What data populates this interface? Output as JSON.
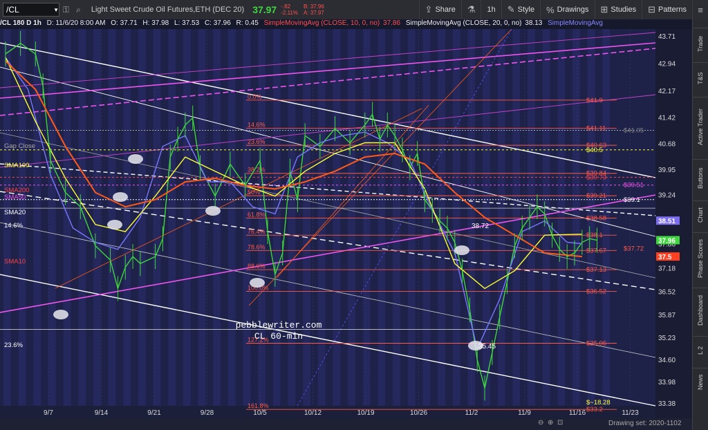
{
  "toolbar": {
    "symbol": "/CL",
    "description": "Light Sweet Crude Oil Futures,ETH (DEC 20)",
    "last": "37.97",
    "change": "-.82",
    "change_pct": "-2.11%",
    "bid": "B: 37.96",
    "ask": "A: 37.97",
    "share": "Share",
    "timeframe": "1h",
    "style": "Style",
    "drawings": "Drawings",
    "studies": "Studies",
    "patterns": "Patterns",
    "colors": {
      "bg": "#2b2d33",
      "last": "#3fd63f",
      "change": "#ff5050"
    }
  },
  "infobar": {
    "title": "/CL 180 D 1h",
    "date": "D: 11/6/20 8:00 AM",
    "open": "O: 37.71",
    "high": "H: 37.98",
    "low": "L: 37.53",
    "close": "C: 37.96",
    "range": "R: 0.45",
    "sma10_label": "SimpleMovingAvg (CLOSE, 10, 0, no)",
    "sma10_value": "37.86",
    "sma20_label": "SimpleMovingAvg (CLOSE, 20, 0, no)",
    "sma20_value": "38.13",
    "sma_cut": "SimpleMovingAvg"
  },
  "right_tabs": [
    "Trade",
    "T&S",
    "Active Trader",
    "Buttons",
    "Chart",
    "Phase Scores",
    "Dashboard",
    "L 2",
    "News"
  ],
  "footer": {
    "drawing_set": "Drawing set: 2020-1102"
  },
  "watermark": {
    "line1": "pebblewriter.com",
    "line2": "CL 60-min"
  },
  "annotations": {
    "gap_close": "Gap Close",
    "sma100": "SMA100",
    "sma200": "SMA200",
    "sma50": "SMA50",
    "sma20": "SMA20",
    "sma10": "SMA10",
    "fib_14_left": "14.6%",
    "fib_23_left": "23.6%",
    "fib_127_left": "127.2%",
    "hi_38_72": "38.72",
    "lo_35_45": "35.45",
    "fib_labels": [
      "0.0%",
      "14.6%",
      "23.6%",
      "38.2%",
      "50%",
      "61.8%",
      "76.4%",
      "78.6%",
      "88.6%",
      "100.0%",
      "127.2%",
      "161.8%"
    ],
    "price_labels": [
      {
        "text": "$41.9",
        "price": 41.9,
        "color": "#ff5a4a"
      },
      {
        "text": "$41.11",
        "price": 41.11,
        "color": "#ff5a4a"
      },
      {
        "text": "$41.05",
        "price": 41.05,
        "color": "#888888"
      },
      {
        "text": "$40.63",
        "price": 40.63,
        "color": "#ff5a4a"
      },
      {
        "text": "$40.5",
        "price": 40.5,
        "color": "#ffff33"
      },
      {
        "text": "$39.84",
        "price": 39.84,
        "color": "#ff5a4a"
      },
      {
        "text": "$39.73",
        "price": 39.73,
        "color": "#ff4444"
      },
      {
        "text": "$39.51",
        "price": 39.51,
        "color": "#ee55ee"
      },
      {
        "text": "$39.21",
        "price": 39.21,
        "color": "#ff5a4a"
      },
      {
        "text": "$39.1",
        "price": 39.1,
        "color": "#ffffff"
      },
      {
        "text": "$38.58",
        "price": 38.58,
        "color": "#ff5a4a"
      },
      {
        "text": "$38.1",
        "price": 38.1,
        "color": "#ff5a4a"
      },
      {
        "text": "$37.67",
        "price": 37.67,
        "color": "#ff5a4a"
      },
      {
        "text": "$37.72",
        "price": 37.72,
        "color": "#ff5a4a"
      },
      {
        "text": "$37.13",
        "price": 37.13,
        "color": "#ff5a4a"
      },
      {
        "text": "$36.52",
        "price": 36.52,
        "color": "#ff5a4a"
      },
      {
        "text": "$35.06",
        "price": 35.06,
        "color": "#ff5a4a"
      },
      {
        "text": "$33.2",
        "price": 33.2,
        "color": "#ff5a4a"
      },
      {
        "text": "$~18.28",
        "price": 33.4,
        "color": "#ffff33"
      }
    ],
    "price_tags": [
      {
        "text": "38.51",
        "price": 38.51,
        "bg": "#7b6cf0"
      },
      {
        "text": "37.96",
        "price": 37.96,
        "bg": "#3fd63f"
      },
      {
        "text": "37.5",
        "price": 37.5,
        "bg": "#ff4020"
      }
    ]
  },
  "chart_data": {
    "type": "line",
    "x_ticks": [
      "9/7",
      "9/14",
      "9/21",
      "9/28",
      "10/5",
      "10/12",
      "10/19",
      "10/26",
      "11/2",
      "11/9",
      "11/16",
      "11/23"
    ],
    "y_ticks": [
      43.71,
      42.94,
      42.17,
      41.42,
      40.68,
      39.95,
      39.24,
      38.51,
      37.86,
      37.18,
      36.52,
      35.87,
      35.23,
      34.6,
      33.98,
      33.38
    ],
    "ylim": [
      33.3,
      43.9
    ],
    "series": [
      {
        "name": "Price",
        "color": "#3fd63f",
        "x": [
          0,
          2,
          4,
          5,
          6,
          8,
          10,
          12,
          14,
          15,
          16,
          17,
          18,
          20,
          21,
          22,
          23,
          24,
          25,
          26,
          28,
          30,
          32,
          34,
          35,
          36,
          37,
          38,
          39,
          40,
          42,
          44,
          46,
          48,
          49,
          50,
          51,
          52,
          53,
          54,
          55,
          56,
          57,
          58,
          59,
          60,
          61,
          62,
          63,
          64,
          65,
          66,
          67,
          68,
          69,
          70,
          71,
          72,
          73,
          74,
          75,
          76,
          77,
          78,
          79,
          80,
          81
        ],
        "y": [
          43.2,
          43.5,
          43.2,
          42.3,
          40.2,
          39.3,
          38.9,
          37.8,
          37.4,
          36.6,
          37.2,
          37.5,
          37.3,
          37.5,
          38.0,
          40.3,
          40.8,
          41.2,
          41.4,
          40.0,
          39.2,
          40.1,
          39.5,
          40.2,
          38.2,
          37.0,
          37.6,
          39.9,
          39.1,
          40.9,
          40.6,
          41.1,
          40.7,
          41.2,
          41.5,
          40.8,
          41.2,
          40.9,
          40.5,
          40.0,
          40.4,
          39.1,
          38.8,
          38.5,
          38.3,
          37.9,
          37.1,
          36.0,
          34.6,
          33.8,
          34.8,
          35.8,
          36.8,
          37.8,
          38.3,
          38.6,
          38.9,
          38.7,
          38.1,
          37.7,
          37.5,
          37.6,
          37.9,
          38.0,
          37.96,
          null,
          null
        ]
      },
      {
        "name": "SMA10",
        "color": "#7777ff",
        "x": [
          0,
          3,
          6,
          9,
          12,
          15,
          18,
          21,
          24,
          27,
          30,
          33,
          36,
          39,
          42,
          45,
          48,
          51,
          54,
          57,
          60,
          63,
          66,
          69,
          72,
          75,
          77
        ],
        "y": [
          43.1,
          42.2,
          39.8,
          38.3,
          37.9,
          37.7,
          38.6,
          40.6,
          40.9,
          39.6,
          39.6,
          38.9,
          38.7,
          40.3,
          40.7,
          40.9,
          41.0,
          40.7,
          40.2,
          38.8,
          37.6,
          34.9,
          36.3,
          38.2,
          38.5,
          37.9,
          37.86
        ]
      },
      {
        "name": "SMA20",
        "color": "#ffff33",
        "x": [
          0,
          4,
          8,
          12,
          16,
          20,
          24,
          28,
          32,
          36,
          40,
          44,
          48,
          52,
          56,
          60,
          64,
          68,
          72,
          77
        ],
        "y": [
          43.1,
          41.3,
          39.7,
          38.4,
          38.2,
          39.2,
          40.3,
          39.9,
          39.5,
          39.2,
          39.9,
          40.4,
          40.7,
          40.7,
          39.4,
          37.3,
          36.6,
          37.1,
          38.1,
          38.13
        ]
      },
      {
        "name": "SMA50",
        "color": "#ff5a1a",
        "x": [
          0,
          4,
          8,
          12,
          16,
          20,
          24,
          28,
          32,
          36,
          40,
          44,
          48,
          52,
          56,
          60,
          64,
          68,
          72,
          77
        ],
        "y": [
          43.0,
          42.2,
          40.6,
          39.3,
          38.9,
          39.1,
          39.6,
          39.7,
          39.5,
          39.4,
          39.6,
          39.9,
          40.3,
          40.4,
          40.1,
          39.3,
          38.6,
          38.1,
          37.6,
          37.5
        ]
      }
    ]
  }
}
